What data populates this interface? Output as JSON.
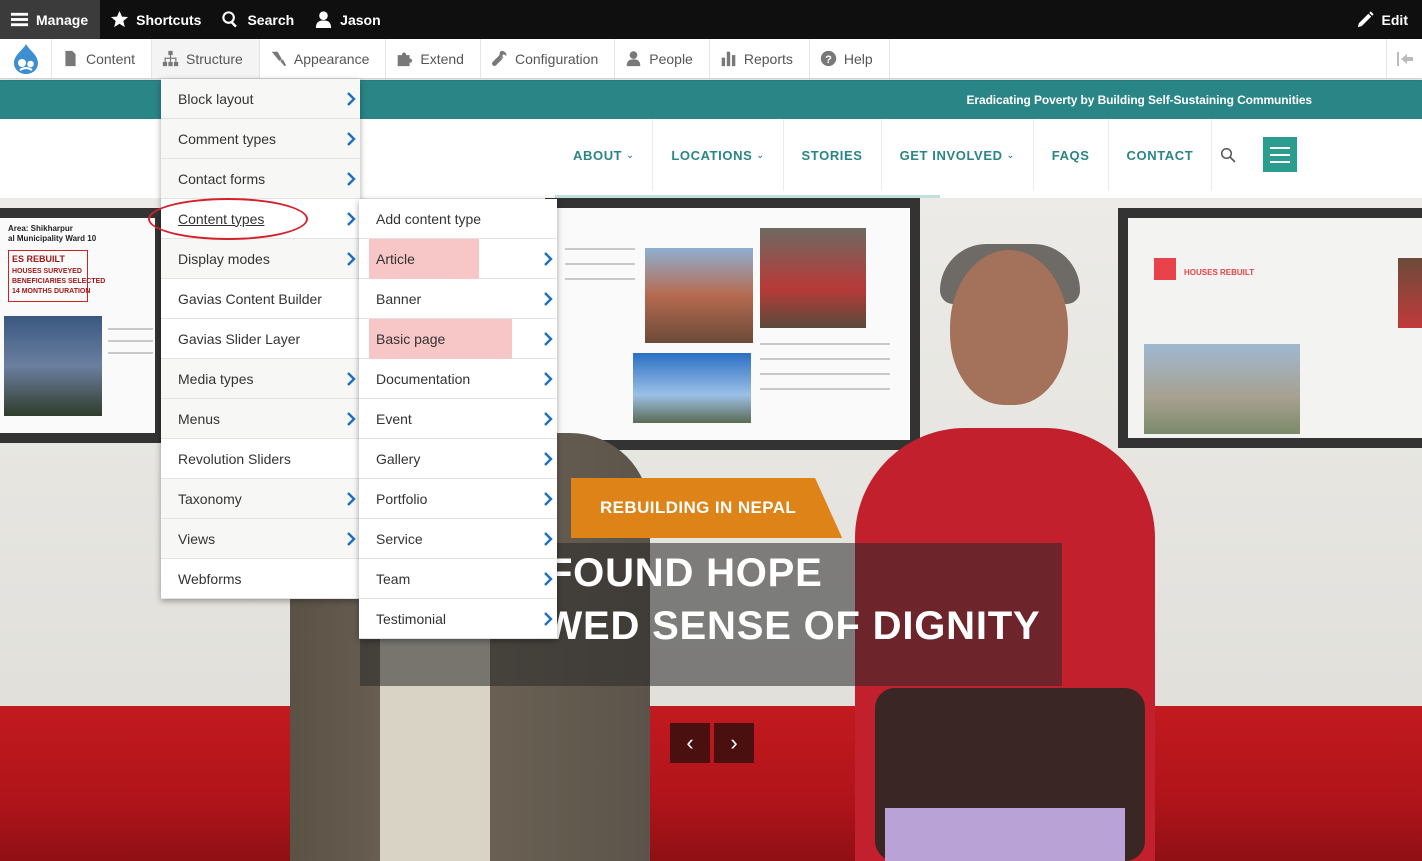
{
  "toolbar": {
    "manage": "Manage",
    "shortcuts": "Shortcuts",
    "search": "Search",
    "user": "Jason",
    "edit": "Edit"
  },
  "tray": {
    "items": [
      {
        "label": "Content",
        "icon": "file-icon"
      },
      {
        "label": "Structure",
        "icon": "sitemap-icon"
      },
      {
        "label": "Appearance",
        "icon": "paintbrush-icon"
      },
      {
        "label": "Extend",
        "icon": "puzzle-icon"
      },
      {
        "label": "Configuration",
        "icon": "wrench-icon"
      },
      {
        "label": "People",
        "icon": "person-icon"
      },
      {
        "label": "Reports",
        "icon": "bar-chart-icon"
      },
      {
        "label": "Help",
        "icon": "question-icon"
      }
    ]
  },
  "site": {
    "tagline": "Eradicating Poverty by Building Self-Sustaining Communities",
    "nav": [
      {
        "label": "ABOUT",
        "dropdown": true
      },
      {
        "label": "LOCATIONS",
        "dropdown": true
      },
      {
        "label": "STORIES",
        "dropdown": false
      },
      {
        "label": "GET INVOLVED",
        "dropdown": true
      },
      {
        "label": "FAQS",
        "dropdown": false
      },
      {
        "label": "CONTACT",
        "dropdown": false
      }
    ],
    "accent": "#2a8586"
  },
  "hero": {
    "badge": "REBUILDING IN NEPAL",
    "line1": "EW FOUND HOPE",
    "line2": "A RENEWED SENSE OF DIGNITY",
    "prev": "‹",
    "next": "›",
    "poster_text": [
      "Area: Shikharpur",
      "al Municipality Ward 10",
      "ES REBUILT",
      "HOUSES SURVEYED",
      "BENEFICIARIES SELECTED",
      "14 MONTHS DURATION",
      "HOUSES REBUILT"
    ]
  },
  "structure_menu": {
    "items": [
      {
        "label": "Block layout",
        "arrow": true
      },
      {
        "label": "Comment types",
        "arrow": true
      },
      {
        "label": "Contact forms",
        "arrow": true
      },
      {
        "label": "Content types",
        "arrow": true
      },
      {
        "label": "Display modes",
        "arrow": true
      },
      {
        "label": "Gavias Content Builder",
        "arrow": false
      },
      {
        "label": "Gavias Slider Layer",
        "arrow": false
      },
      {
        "label": "Media types",
        "arrow": true
      },
      {
        "label": "Menus",
        "arrow": true
      },
      {
        "label": "Revolution Sliders",
        "arrow": false
      },
      {
        "label": "Taxonomy",
        "arrow": true
      },
      {
        "label": "Views",
        "arrow": true
      },
      {
        "label": "Webforms",
        "arrow": false
      }
    ]
  },
  "content_types_menu": {
    "items": [
      {
        "label": "Add content type",
        "arrow": false
      },
      {
        "label": "Article",
        "arrow": true,
        "highlight": true
      },
      {
        "label": "Banner",
        "arrow": true
      },
      {
        "label": "Basic page",
        "arrow": true,
        "highlight": true
      },
      {
        "label": "Documentation",
        "arrow": true
      },
      {
        "label": "Event",
        "arrow": true
      },
      {
        "label": "Gallery",
        "arrow": true
      },
      {
        "label": "Portfolio",
        "arrow": true
      },
      {
        "label": "Service",
        "arrow": true
      },
      {
        "label": "Team",
        "arrow": true
      },
      {
        "label": "Testimonial",
        "arrow": true
      }
    ]
  }
}
